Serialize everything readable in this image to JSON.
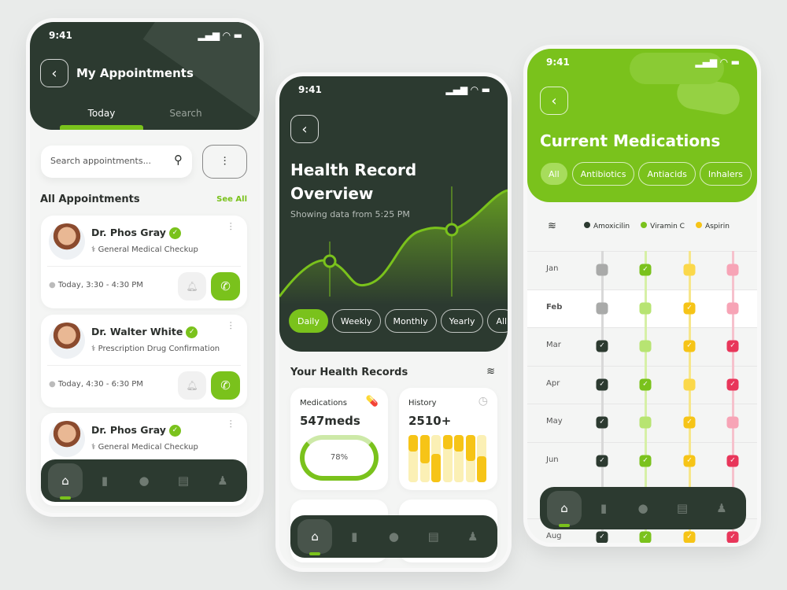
{
  "colors": {
    "dark": "#2c3a30",
    "green": "#7ac21c",
    "yellow": "#f6c417",
    "red": "#e8365a"
  },
  "status_time": "9:41",
  "appointments": {
    "title": "My Appointments",
    "tabs": [
      "Today",
      "Search"
    ],
    "search_placeholder": "Search appointments...",
    "section_title": "All Appointments",
    "see_all": "See All",
    "items": [
      {
        "doctor": "Dr. Phos Gray",
        "type": "General Medical Checkup",
        "time": "Today, 3:30 - 4:30 PM"
      },
      {
        "doctor": "Dr. Walter White",
        "type": "Prescription Drug Confirmation",
        "time": "Today, 4:30 - 6:30 PM"
      },
      {
        "doctor": "Dr. Phos Gray",
        "type": "General Medical Checkup",
        "time": ""
      }
    ]
  },
  "health": {
    "title_line1": "Health Record",
    "title_line2": "Overview",
    "subtitle": "Showing data from 5:25 PM",
    "periods": [
      "Daily",
      "Weekly",
      "Monthly",
      "Yearly",
      "All"
    ],
    "active_period": "Daily",
    "records_title": "Your Health Records",
    "medications": {
      "label": "Medications",
      "value": "547meds",
      "progress_label": "78%",
      "progress": 78
    },
    "history": {
      "label": "History",
      "value": "2510+"
    }
  },
  "medications": {
    "title": "Current Medications",
    "filters": [
      "All",
      "Antibiotics",
      "Antiacids",
      "Inhalers"
    ],
    "legend": [
      {
        "name": "Amoxicilin",
        "color": "#2c3a30"
      },
      {
        "name": "Viramin C",
        "color": "#7ac21c"
      },
      {
        "name": "Aspirin",
        "color": "#f6c417"
      }
    ],
    "rows": [
      {
        "month": "Jan",
        "taken": [
          false,
          true,
          false,
          false
        ]
      },
      {
        "month": "Feb",
        "taken": [
          false,
          false,
          true,
          false
        ]
      },
      {
        "month": "Mar",
        "taken": [
          true,
          false,
          true,
          true
        ]
      },
      {
        "month": "Apr",
        "taken": [
          true,
          true,
          false,
          true
        ]
      },
      {
        "month": "May",
        "taken": [
          true,
          false,
          true,
          false
        ]
      },
      {
        "month": "Jun",
        "taken": [
          true,
          true,
          true,
          true
        ]
      },
      {
        "month": "Aug",
        "taken": [
          true,
          true,
          true,
          true
        ]
      }
    ]
  },
  "nav_icons": [
    "home-icon",
    "chart-icon",
    "chat-icon",
    "document-icon",
    "profile-icon"
  ]
}
